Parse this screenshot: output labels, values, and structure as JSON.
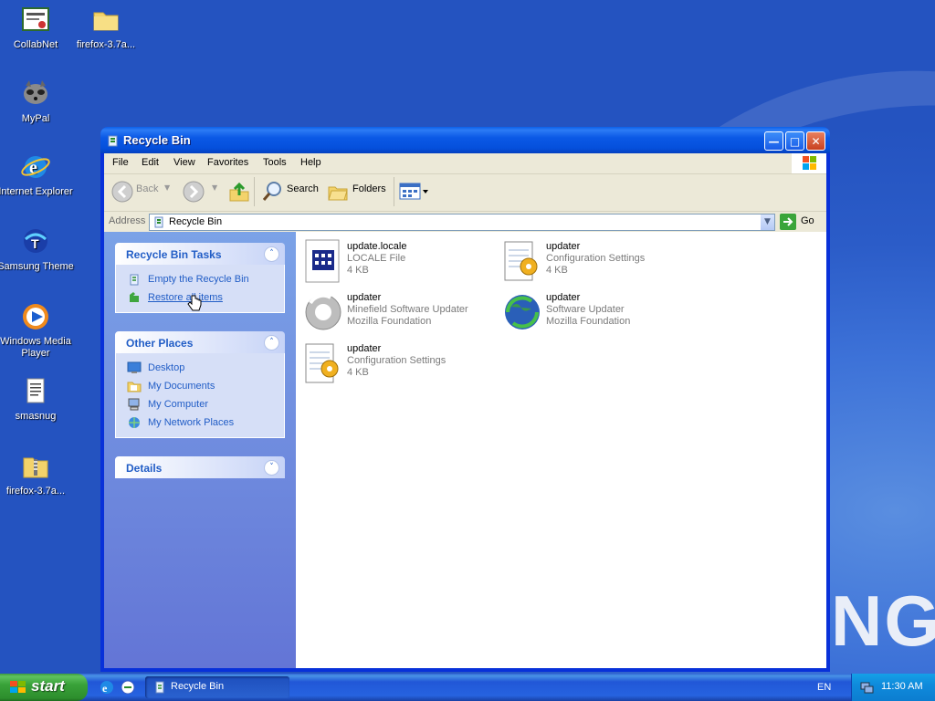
{
  "desktop": {
    "brand_text": "NG",
    "icons": [
      {
        "label": "CollabNet",
        "icon": "certificate-icon"
      },
      {
        "label": "firefox-3.7a...",
        "icon": "folder-icon"
      },
      {
        "label": "MyPal",
        "icon": "raccoon-icon"
      },
      {
        "label": "Internet Explorer",
        "icon": "internet-explorer-icon"
      },
      {
        "label": "Samsung Theme",
        "icon": "samsung-theme-icon"
      },
      {
        "label": "Windows Media Player",
        "icon": "media-player-icon"
      },
      {
        "label": "smasnug",
        "icon": "text-file-icon"
      },
      {
        "label": "firefox-3.7a...",
        "icon": "zip-folder-icon"
      }
    ]
  },
  "window": {
    "title": "Recycle Bin",
    "menu": [
      "File",
      "Edit",
      "View",
      "Favorites",
      "Tools",
      "Help"
    ],
    "toolbar": {
      "back": "Back",
      "search": "Search",
      "folders": "Folders"
    },
    "address": {
      "label": "Address",
      "value": "Recycle Bin",
      "go": "Go"
    },
    "tasks": {
      "title": "Recycle Bin Tasks",
      "items": [
        "Empty the Recycle Bin",
        "Restore all items"
      ]
    },
    "other_places": {
      "title": "Other Places",
      "items": [
        "Desktop",
        "My Documents",
        "My Computer",
        "My Network Places"
      ]
    },
    "details": {
      "title": "Details"
    },
    "files": [
      {
        "name": "update.locale",
        "line2": "LOCALE File",
        "line3": "4 KB",
        "icon": "locale-file-icon"
      },
      {
        "name": "updater",
        "line2": "Configuration Settings",
        "line3": "4 KB",
        "icon": "config-file-icon"
      },
      {
        "name": "updater",
        "line2": "Minefield Software Updater",
        "line3": "Mozilla Foundation",
        "icon": "minefield-updater-icon"
      },
      {
        "name": "updater",
        "line2": "Software Updater",
        "line3": "Mozilla Foundation",
        "icon": "firefox-updater-icon"
      },
      {
        "name": "updater",
        "line2": "Configuration Settings",
        "line3": "4 KB",
        "icon": "config-file-icon"
      }
    ]
  },
  "taskbar": {
    "start": "start",
    "task_item": "Recycle Bin",
    "language": "EN",
    "clock": "11:30 AM"
  }
}
